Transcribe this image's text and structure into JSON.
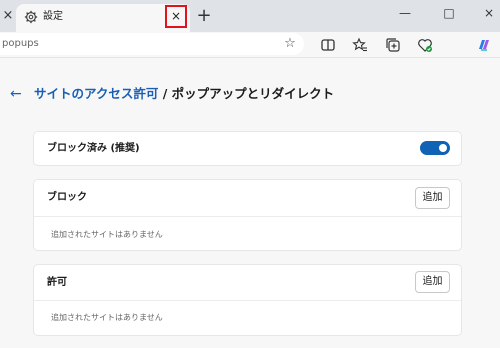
{
  "tab_bar": {
    "left_tab_close_glyph": "×",
    "active_tab": {
      "title": "設定",
      "icon": "gear-icon",
      "close_glyph": "×"
    },
    "new_tab_glyph": "+",
    "window_controls": {
      "minimize": "—",
      "maximize": "□",
      "close": "×"
    }
  },
  "address_bar": {
    "url_text": "popups",
    "icons": [
      "favorite-star-icon",
      "split-screen-icon",
      "favorites-icon",
      "collections-icon",
      "browser-essentials-icon",
      "copilot-icon"
    ]
  },
  "page": {
    "back_glyph": "←",
    "breadcrumb_link": "サイトのアクセス許可",
    "breadcrumb_separator": " / ",
    "title": "ポップアップとリダイレクト"
  },
  "blocked_setting": {
    "label": "ブロック済み (推奨)",
    "enabled": true
  },
  "block_section": {
    "label": "ブロック",
    "add_label": "追加",
    "empty_message": "追加されたサイトはありません"
  },
  "allow_section": {
    "label": "許可",
    "add_label": "追加",
    "empty_message": "追加されたサイトはありません"
  },
  "colors": {
    "accent": "#1a5fb4",
    "toggle_on": "#0f62b4",
    "highlight_box": "#e0141e"
  }
}
